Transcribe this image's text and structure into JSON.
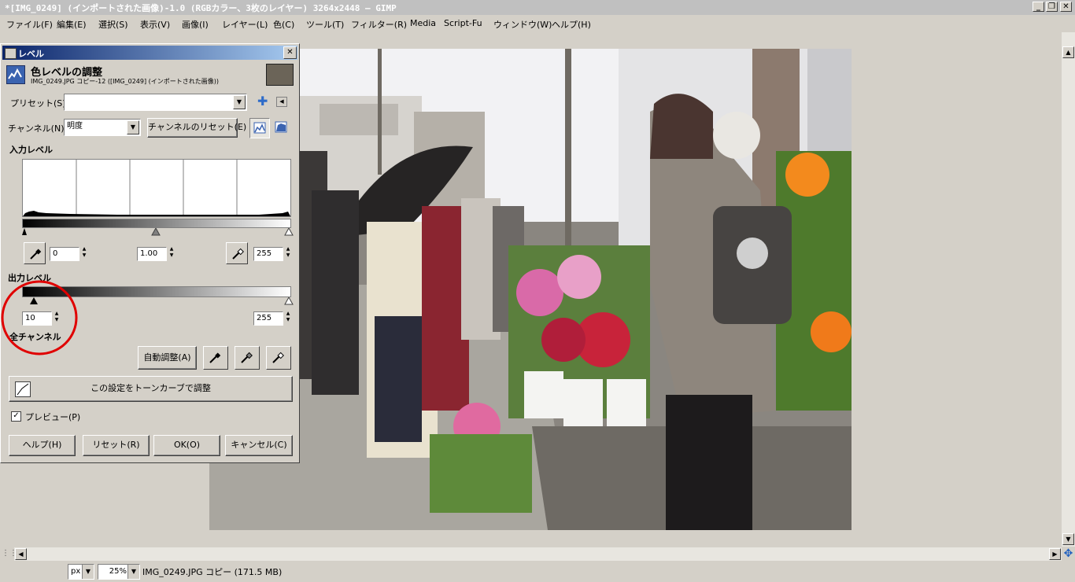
{
  "window": {
    "title": "*[IMG_0249] (インポートされた画像)-1.0 (RGBカラー、3枚のレイヤー) 3264x2448 – GIMP"
  },
  "menu": {
    "items": [
      "ファイル(F)",
      "編集(E)",
      "選択(S)",
      "表示(V)",
      "画像(I)",
      "レイヤー(L)",
      "色(C)",
      "ツール(T)",
      "フィルター(R)",
      "Media",
      "Script-Fu",
      "ウィンドウ(W)",
      "ヘルプ(H)"
    ]
  },
  "dialog": {
    "title": "レベル",
    "header_title": "色レベルの調整",
    "header_subtitle": "IMG_0249.JPG コピー-12 ([IMG_0249] (インポートされた画像))",
    "preset_label": "プリセット(S):",
    "preset_value": "",
    "channel_label": "チャンネル(N):",
    "channel_value": "明度",
    "reset_channel_button": "チャンネルのリセット(E)",
    "input_levels_heading": "入力レベル",
    "input_low": "0",
    "input_gamma": "1.00",
    "input_high": "255",
    "output_levels_heading": "出力レベル",
    "output_low": "10",
    "output_high": "255",
    "all_channels_heading": "全チャンネル",
    "auto_button": "自動調整(A)",
    "curves_button": "この設定をトーンカーブで調整",
    "preview_label": "プレビュー(P)",
    "preview_checked": true,
    "help_button": "ヘルプ(H)",
    "reset_button": "リセット(R)",
    "ok_button": "OK(O)",
    "cancel_button": "キャンセル(C)"
  },
  "statusbar": {
    "unit": "px",
    "zoom": "25%",
    "info": "IMG_0249.JPG コピー (171.5 MB)"
  },
  "colors": {
    "title_gradient_start": "#0a246a",
    "title_gradient_end": "#a6caf0",
    "annotation_circle": "#e00000"
  }
}
